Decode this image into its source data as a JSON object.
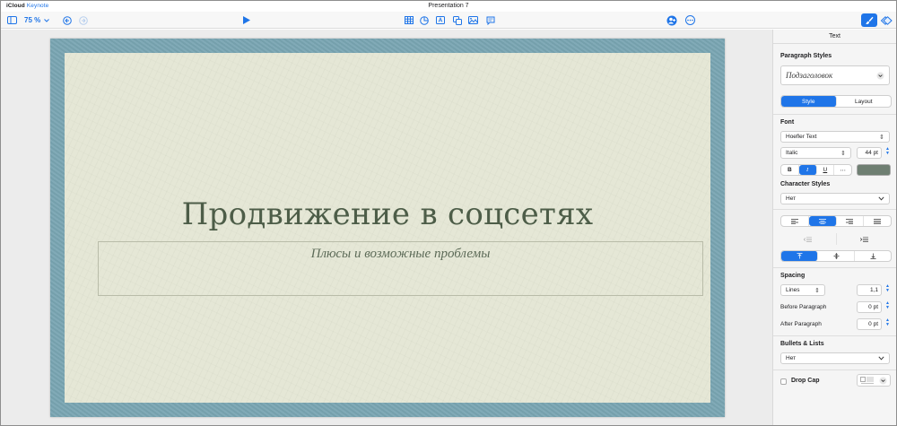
{
  "app": {
    "brand_icloud": "iCloud",
    "brand_app": "Keynote",
    "document_title": "Presentation 7"
  },
  "toolbar": {
    "zoom": "75 %",
    "icons": [
      "sidebar-icon",
      "undo-icon",
      "redo-icon",
      "play-icon",
      "table-icon",
      "chart-icon",
      "text-icon",
      "shape-icon",
      "media-icon",
      "comment-icon",
      "collaborate-icon",
      "more-icon",
      "format-icon",
      "animate-icon"
    ]
  },
  "slide": {
    "title": "Продвижение в соцсетях",
    "subtitle": "Плюсы и возможные проблемы",
    "colors": {
      "frame": "#7aa6b3",
      "paper": "#e5e7d6",
      "title_text": "#4d5d48"
    }
  },
  "inspector": {
    "header": "Text",
    "paragraph_styles_label": "Paragraph Styles",
    "paragraph_style_value": "Подзаголовок",
    "tabs": {
      "style": "Style",
      "layout": "Layout"
    },
    "font_label": "Font",
    "font_family": "Hoefler Text",
    "font_typeface": "Italic",
    "font_size": "44 pt",
    "bold": "B",
    "italic": "I",
    "underline": "U",
    "more": "⋯",
    "text_color": "#6f7f72",
    "character_styles_label": "Character Styles",
    "character_style_value": "Нет",
    "spacing_label": "Spacing",
    "spacing_mode": "Lines",
    "spacing_value": "1,1",
    "before_paragraph_label": "Before Paragraph",
    "before_paragraph_value": "0 pt",
    "after_paragraph_label": "After Paragraph",
    "after_paragraph_value": "0 pt",
    "bullets_label": "Bullets & Lists",
    "bullets_value": "Нет",
    "drop_cap_label": "Drop Cap"
  },
  "accent_color": "#1f75e8"
}
